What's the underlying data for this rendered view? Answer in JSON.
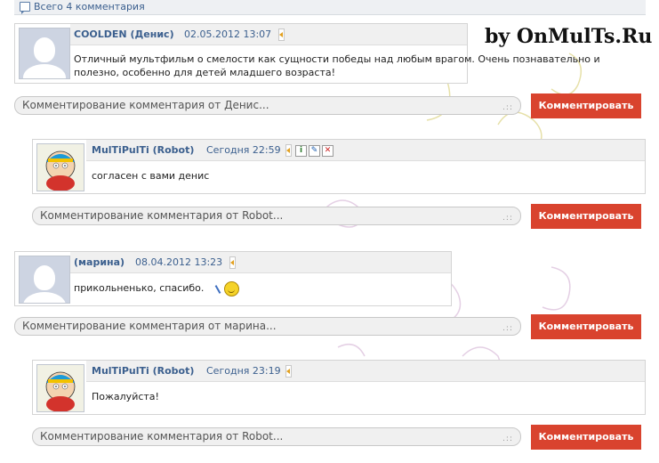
{
  "header": {
    "comments_count_label": "Всего 4 комментария"
  },
  "watermark": "by OnMulTs.Ru",
  "comments": [
    {
      "author": "COOLDEN (Денис)",
      "date": "02.05.2012 13:07",
      "text": "Отличный мультфильм о смелости как сущности победы над любым врагом. Очень познавательно и полезно, особенно для детей младшего возраста!"
    },
    {
      "author": "MulTiPulTi (Robot)",
      "date": "Сегодня 22:59",
      "text": "согласен с вами денис"
    },
    {
      "author": "(марина)",
      "date": "08.04.2012 13:23",
      "text": "прикольненько, спасибо."
    },
    {
      "author": "MulTiPulTi (Robot)",
      "date": "Сегодня 23:19",
      "text": "Пожалуйста!"
    }
  ],
  "reply_placeholders": [
    "Комментирование комментария от Денис...",
    "Комментирование комментария от Robot...",
    "Комментирование комментария от марина...",
    "Комментирование комментария от Robot..."
  ],
  "comment_button_label": "Комментировать",
  "admin_icons": [
    "info-icon",
    "edit-icon",
    "delete-icon"
  ],
  "colors": {
    "accent_button": "#d9432e",
    "link": "#3b5f8e"
  }
}
